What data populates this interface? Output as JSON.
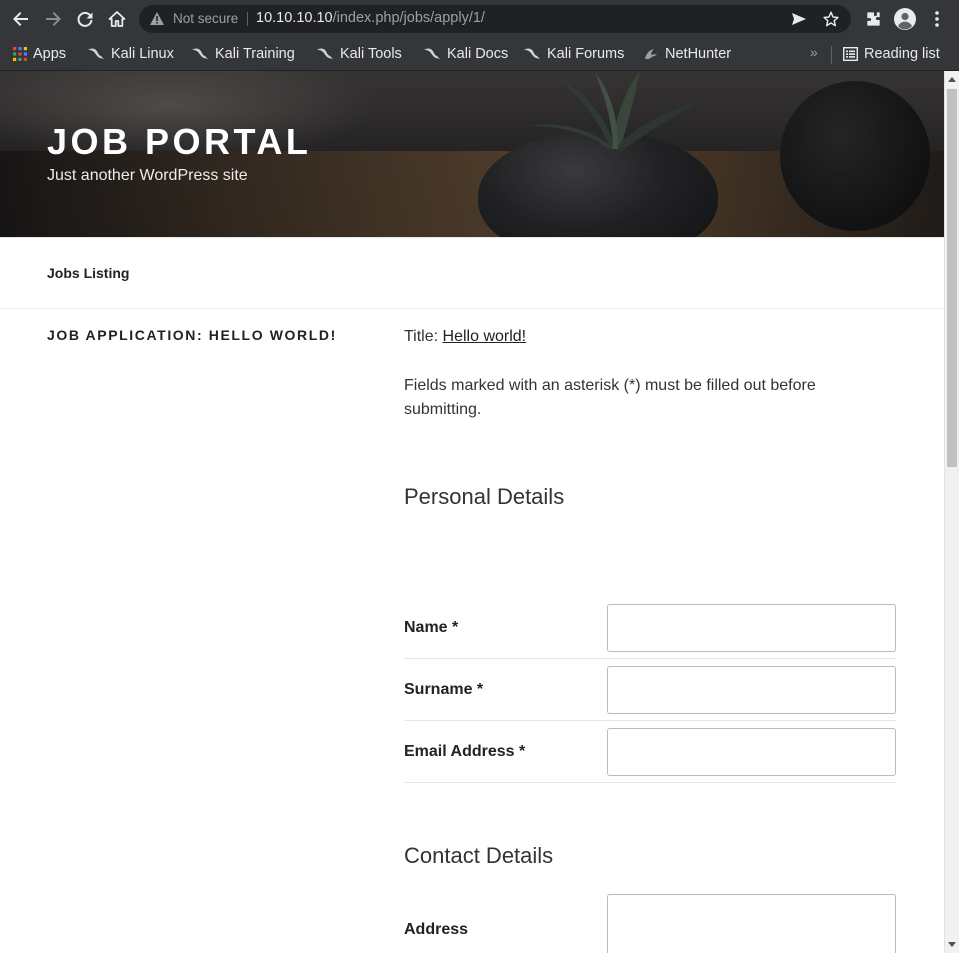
{
  "browser": {
    "security_label": "Not secure",
    "url_host": "10.10.10.10",
    "url_path": "/index.php/jobs/apply/1/",
    "bookmarks": [
      {
        "label": "Apps",
        "icon": "apps-grid-icon"
      },
      {
        "label": "Kali Linux",
        "icon": "kali-dragon-icon"
      },
      {
        "label": "Kali Training",
        "icon": "kali-dragon-icon"
      },
      {
        "label": "Kali Tools",
        "icon": "kali-dragon-icon"
      },
      {
        "label": "Kali Docs",
        "icon": "kali-dragon-icon"
      },
      {
        "label": "Kali Forums",
        "icon": "kali-dragon-icon"
      },
      {
        "label": "NetHunter",
        "icon": "nethunter-icon"
      }
    ],
    "overflow_chevron": "»",
    "reading_list_label": "Reading list",
    "colors": {
      "toolbar": "#35363a",
      "omnibox": "#202124"
    }
  },
  "site": {
    "title": "JOB PORTAL",
    "description": "Just another WordPress site",
    "nav_items": [
      "Jobs Listing"
    ]
  },
  "main": {
    "entry_title": "JOB APPLICATION: HELLO WORLD!",
    "title_prefix": "Title:",
    "title_link": "Hello world!",
    "required_notice": "Fields marked with an asterisk (*) must be filled out before submitting.",
    "sections": [
      {
        "title": "Personal Details",
        "fields": [
          {
            "label": "Name *",
            "value": ""
          },
          {
            "label": "Surname *",
            "value": ""
          },
          {
            "label": "Email Address *",
            "value": ""
          }
        ]
      },
      {
        "title": "Contact Details",
        "fields": [
          {
            "label": "Address",
            "value": ""
          }
        ]
      }
    ]
  }
}
